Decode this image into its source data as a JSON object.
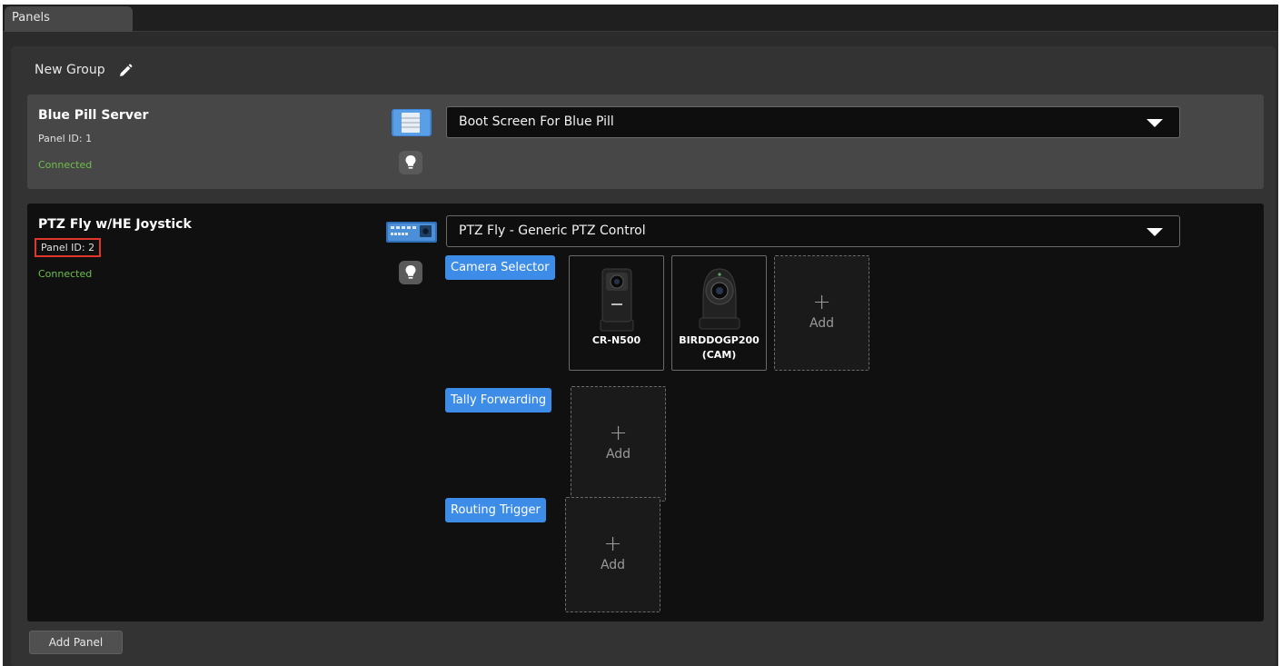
{
  "tabs": [
    {
      "label": "Panels"
    }
  ],
  "group": {
    "title": "New Group",
    "edit_icon": "pencil-icon"
  },
  "panels": [
    {
      "name": "Blue Pill Server",
      "panel_id": "Panel ID: 1",
      "status": "Connected",
      "device_icon": "server-icon",
      "light_icon": "lightbulb-icon",
      "config": "Boot Screen For Blue Pill"
    },
    {
      "name": "PTZ Fly w/HE Joystick",
      "panel_id": "Panel ID: 2",
      "status": "Connected",
      "device_icon": "control-panel-icon",
      "light_icon": "lightbulb-icon",
      "config": "PTZ Fly - Generic PTZ Control",
      "sections": [
        {
          "label": "Camera Selector",
          "items": [
            {
              "name": "CR-N500"
            },
            {
              "name": "BIRDDOGP200 (CAM)"
            }
          ],
          "add_label": "Add"
        },
        {
          "label": "Tally Forwarding",
          "items": [],
          "add_label": "Add"
        },
        {
          "label": "Routing Trigger",
          "items": [],
          "add_label": "Add"
        }
      ]
    }
  ],
  "add_panel_label": "Add Panel",
  "colors": {
    "accent": "#3d8de8",
    "connected": "#6fbf4a",
    "highlight_box": "#e0352a"
  }
}
